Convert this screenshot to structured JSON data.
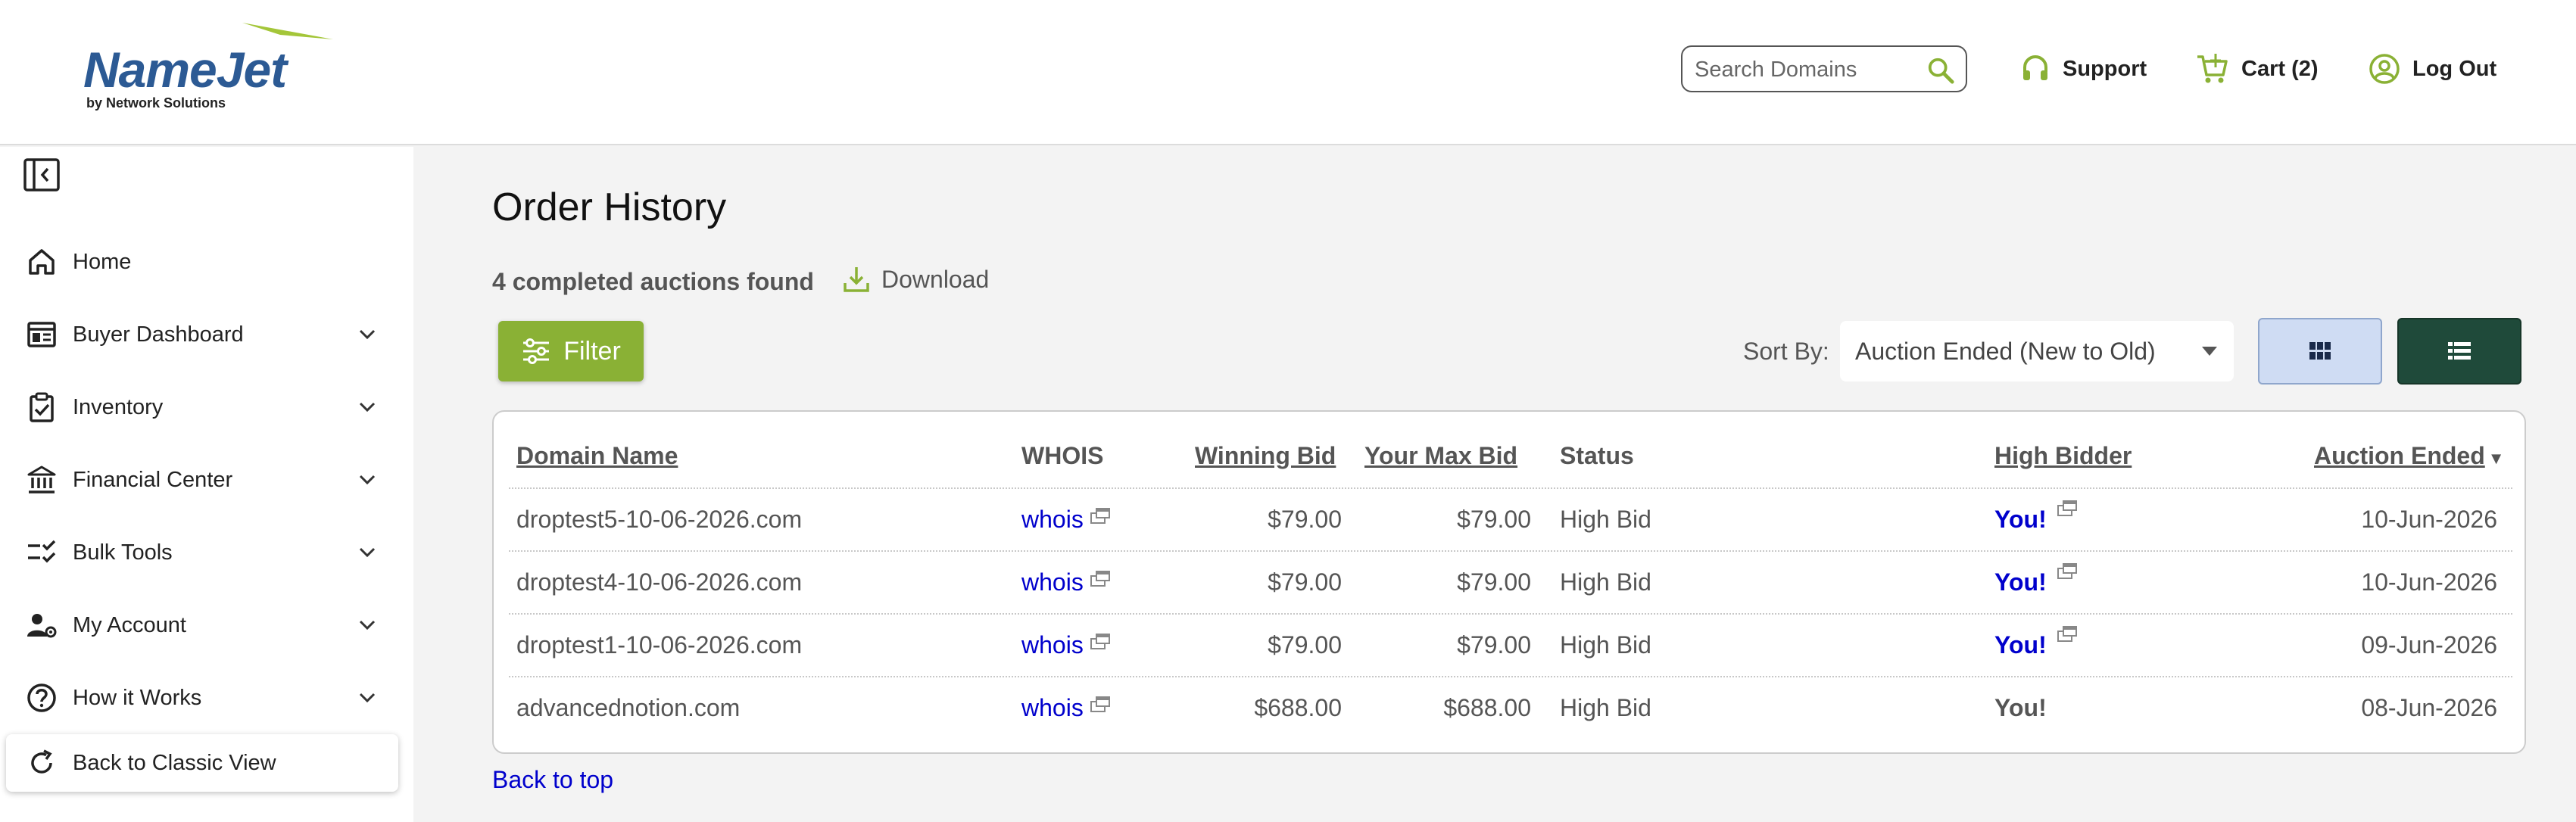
{
  "header": {
    "logo_text": "NameJet",
    "logo_sub": "by Network Solutions",
    "search_placeholder": "Search Domains",
    "support_label": "Support",
    "cart_label": "Cart (2)",
    "logout_label": "Log Out"
  },
  "sidebar": {
    "items": [
      {
        "label": "Home",
        "icon": "home-icon",
        "expandable": false
      },
      {
        "label": "Buyer Dashboard",
        "icon": "dashboard-icon",
        "expandable": true
      },
      {
        "label": "Inventory",
        "icon": "clipboard-check-icon",
        "expandable": true
      },
      {
        "label": "Financial Center",
        "icon": "bank-icon",
        "expandable": true
      },
      {
        "label": "Bulk Tools",
        "icon": "checklist-icon",
        "expandable": true
      },
      {
        "label": "My Account",
        "icon": "user-gear-icon",
        "expandable": true
      },
      {
        "label": "How it Works",
        "icon": "help-circle-icon",
        "expandable": true
      }
    ],
    "classic_view_label": "Back to Classic View"
  },
  "main": {
    "title": "Order History",
    "found_text": "4 completed auctions found",
    "download_label": "Download",
    "filter_label": "Filter",
    "sort_label": "Sort By:",
    "sort_value": "Auction Ended (New to Old)",
    "back_to_top": "Back to top"
  },
  "table": {
    "headers": {
      "domain": "Domain Name",
      "whois": "WHOIS",
      "winning_bid": "Winning Bid",
      "max_bid": "Your Max Bid",
      "status": "Status",
      "high_bidder": "High Bidder",
      "auction_ended": "Auction Ended"
    },
    "rows": [
      {
        "domain": "droptest5-10-06-2026.com",
        "whois": "whois",
        "winning_bid": "$79.00",
        "max_bid": "$79.00",
        "status": "High Bid",
        "high_bidder": "You!",
        "auction_ended": "10-Jun-2026"
      },
      {
        "domain": "droptest4-10-06-2026.com",
        "whois": "whois",
        "winning_bid": "$79.00",
        "max_bid": "$79.00",
        "status": "High Bid",
        "high_bidder": "You!",
        "auction_ended": "10-Jun-2026"
      },
      {
        "domain": "droptest1-10-06-2026.com",
        "whois": "whois",
        "winning_bid": "$79.00",
        "max_bid": "$79.00",
        "status": "High Bid",
        "high_bidder": "You!",
        "auction_ended": "09-Jun-2026"
      },
      {
        "domain": "advancednotion.com",
        "whois": "whois",
        "winning_bid": "$688.00",
        "max_bid": "$688.00",
        "status": "High Bid",
        "high_bidder": "You!",
        "auction_ended": "08-Jun-2026"
      }
    ]
  },
  "colors": {
    "brand_green": "#8ab135",
    "brand_blue": "#2c5a94",
    "link_blue": "#0000cc",
    "list_view_active": "#1f4a3a"
  }
}
